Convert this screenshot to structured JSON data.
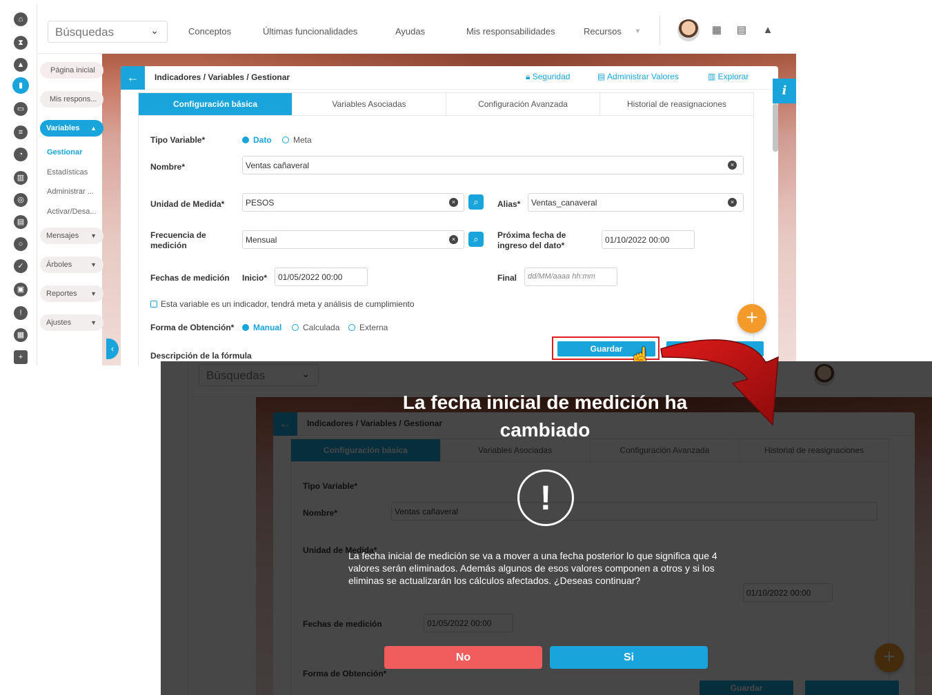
{
  "app": {
    "search_placeholder": "Búsquedas",
    "nav": [
      "Conceptos",
      "Últimas funcionalidades",
      "Ayudas",
      "Mis responsabilidades",
      "Recursos"
    ]
  },
  "sidebar": {
    "items": [
      "Página inicial",
      "Mis respons...",
      "Variables",
      "Mensajes",
      "Árboles",
      "Reportes",
      "Ajustes"
    ],
    "subitems": [
      "Gestionar",
      "Estadísticas",
      "Administrar ...",
      "Activar/Desa..."
    ]
  },
  "panel": {
    "breadcrumb": "Indicadores / Variables / Gestionar",
    "links": [
      "Seguridad",
      "Administrar Valores",
      "Explorar"
    ],
    "tabs": [
      "Configuración básica",
      "Variables Asociadas",
      "Configuración Avanzada",
      "Historial de reasignaciones"
    ]
  },
  "form": {
    "tipo_variable_label": "Tipo Variable*",
    "tipo_options": [
      "Dato",
      "Meta"
    ],
    "nombre_label": "Nombre*",
    "nombre_value": "Ventas cañaveral",
    "unidad_label": "Unidad de Medida*",
    "unidad_value": "PESOS",
    "alias_label": "Alias*",
    "alias_value": "Ventas_canaveral",
    "frecuencia_label": "Frecuencia de medición",
    "frecuencia_value": "Mensual",
    "proxima_label": "Próxima fecha de ingreso del dato*",
    "proxima_value": "01/10/2022 00:00",
    "fechas_label": "Fechas de medición",
    "inicio_label": "Inicio*",
    "inicio_value": "01/05/2022 00:00",
    "final_label": "Final",
    "final_placeholder": "dd/MM/aaaa hh:mm",
    "checkbox_label": "Esta variable es un indicador, tendrá meta y análisis de cumplimiento",
    "forma_label": "Forma de Obtención*",
    "forma_options": [
      "Manual",
      "Calculada",
      "Externa"
    ],
    "descripcion_label": "Descripción de la fórmula",
    "save_button": "Guardar"
  },
  "dialog": {
    "title": "La fecha inicial de medición ha cambiado",
    "icon": "exclamation-icon",
    "message": "La fecha inicial de medición se va a mover a una fecha posterior lo que significa que 4 valores serán eliminados. Además algunos de esos valores componen a otros y si los eliminas se actualizarán los cálculos afectados. ¿Deseas continuar?",
    "no_button": "No",
    "yes_button": "Si"
  },
  "colors": {
    "accent": "#1aa4dc",
    "danger": "#f15c5c",
    "orange": "#f39a2a",
    "highlight": "#e01b1b"
  }
}
